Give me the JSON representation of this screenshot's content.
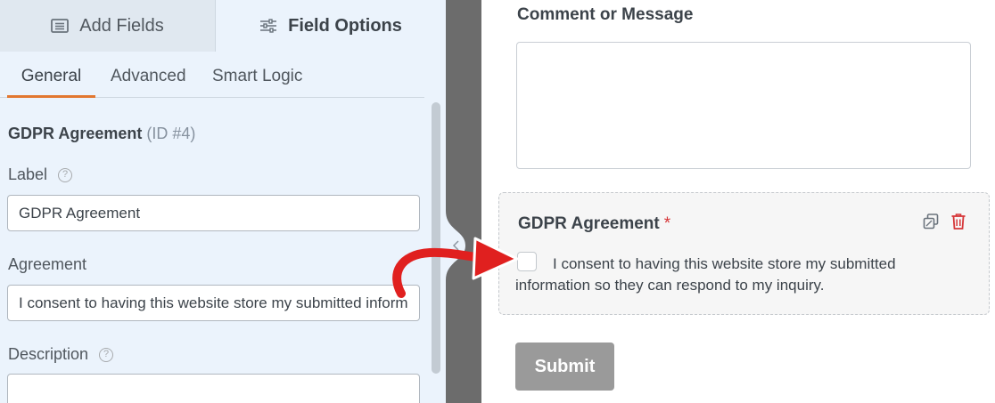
{
  "builder": {
    "top_tabs": {
      "add_fields": "Add Fields",
      "field_options": "Field Options"
    },
    "sub_tabs": {
      "general": "General",
      "advanced": "Advanced",
      "smart_logic": "Smart Logic"
    },
    "field": {
      "name": "GDPR Agreement",
      "id_text": "(ID #4)"
    },
    "label_field": {
      "label": "Label",
      "value": "GDPR Agreement"
    },
    "agreement_field": {
      "label": "Agreement",
      "value": "I consent to having this website store my submitted information so they can respond to my inquiry."
    },
    "description_field": {
      "label": "Description",
      "value": ""
    },
    "help_glyph": "?"
  },
  "preview": {
    "comment_label": "Comment or Message",
    "gdpr": {
      "title": "GDPR Agreement",
      "required_mark": "*",
      "consent_text": "I consent to having this website store my submitted information so they can respond to my inquiry."
    },
    "submit_label": "Submit"
  },
  "colors": {
    "accent": "#e27730",
    "required": "#d63638",
    "annotation_arrow": "#e0201f",
    "panel_bg": "#ebf3fc",
    "divider": "#6c6c6c",
    "submit_bg": "#9a9a9a"
  },
  "icons": {
    "add_fields": "list-icon",
    "field_options": "sliders-icon",
    "duplicate": "duplicate-icon",
    "delete": "trash-icon",
    "help": "help-circle-icon",
    "panel_toggle": "chevron-left-icon"
  }
}
